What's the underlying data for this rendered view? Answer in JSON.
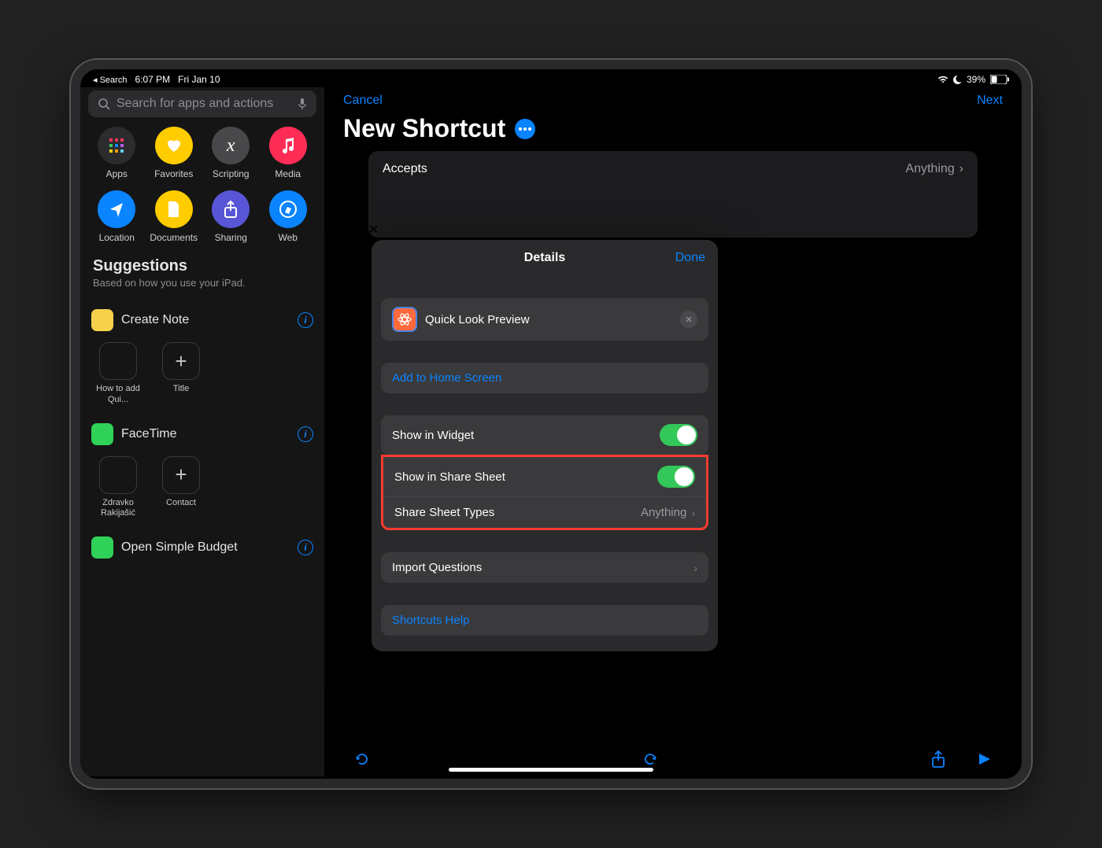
{
  "status": {
    "back": "◂ Search",
    "time": "6:07 PM",
    "date": "Fri Jan 10",
    "battery": "39%"
  },
  "search": {
    "placeholder": "Search for apps and actions"
  },
  "categories": [
    {
      "label": "Apps",
      "color": "#2c2c2e",
      "glyph": "grid"
    },
    {
      "label": "Favorites",
      "color": "#ffcc00",
      "glyph": "heart"
    },
    {
      "label": "Scripting",
      "color": "#48484a",
      "glyph": "fx"
    },
    {
      "label": "Media",
      "color": "#ff2d55",
      "glyph": "music"
    },
    {
      "label": "Location",
      "color": "#0a84ff",
      "glyph": "arrow"
    },
    {
      "label": "Documents",
      "color": "#ffcc00",
      "glyph": "doc"
    },
    {
      "label": "Sharing",
      "color": "#5856d6",
      "glyph": "share"
    },
    {
      "label": "Web",
      "color": "#0a84ff",
      "glyph": "compass"
    }
  ],
  "suggestions": {
    "header": "Suggestions",
    "sub": "Based on how you use your iPad."
  },
  "sugg_sections": [
    {
      "app": "Create Note",
      "color": "#f6d24b",
      "tiles": [
        {
          "label": "How to add Qui..."
        },
        {
          "label": "Title",
          "plus": true
        }
      ]
    },
    {
      "app": "FaceTime",
      "color": "#30d158",
      "tiles": [
        {
          "label": "Zdravko Rakijašić"
        },
        {
          "label": "Contact",
          "plus": true
        }
      ]
    },
    {
      "app": "Open Simple Budget",
      "color": "#30d158",
      "tiles": []
    }
  ],
  "topbar": {
    "cancel": "Cancel",
    "next": "Next"
  },
  "title": "New Shortcut",
  "action": {
    "key": "Accepts",
    "value": "Anything"
  },
  "popover": {
    "title": "Details",
    "done": "Done",
    "name": "Quick Look Preview",
    "add_home": "Add to Home Screen",
    "show_widget": "Show in Widget",
    "show_share": "Show in Share Sheet",
    "share_types_key": "Share Sheet Types",
    "share_types_val": "Anything",
    "import_q": "Import Questions",
    "help": "Shortcuts Help"
  }
}
